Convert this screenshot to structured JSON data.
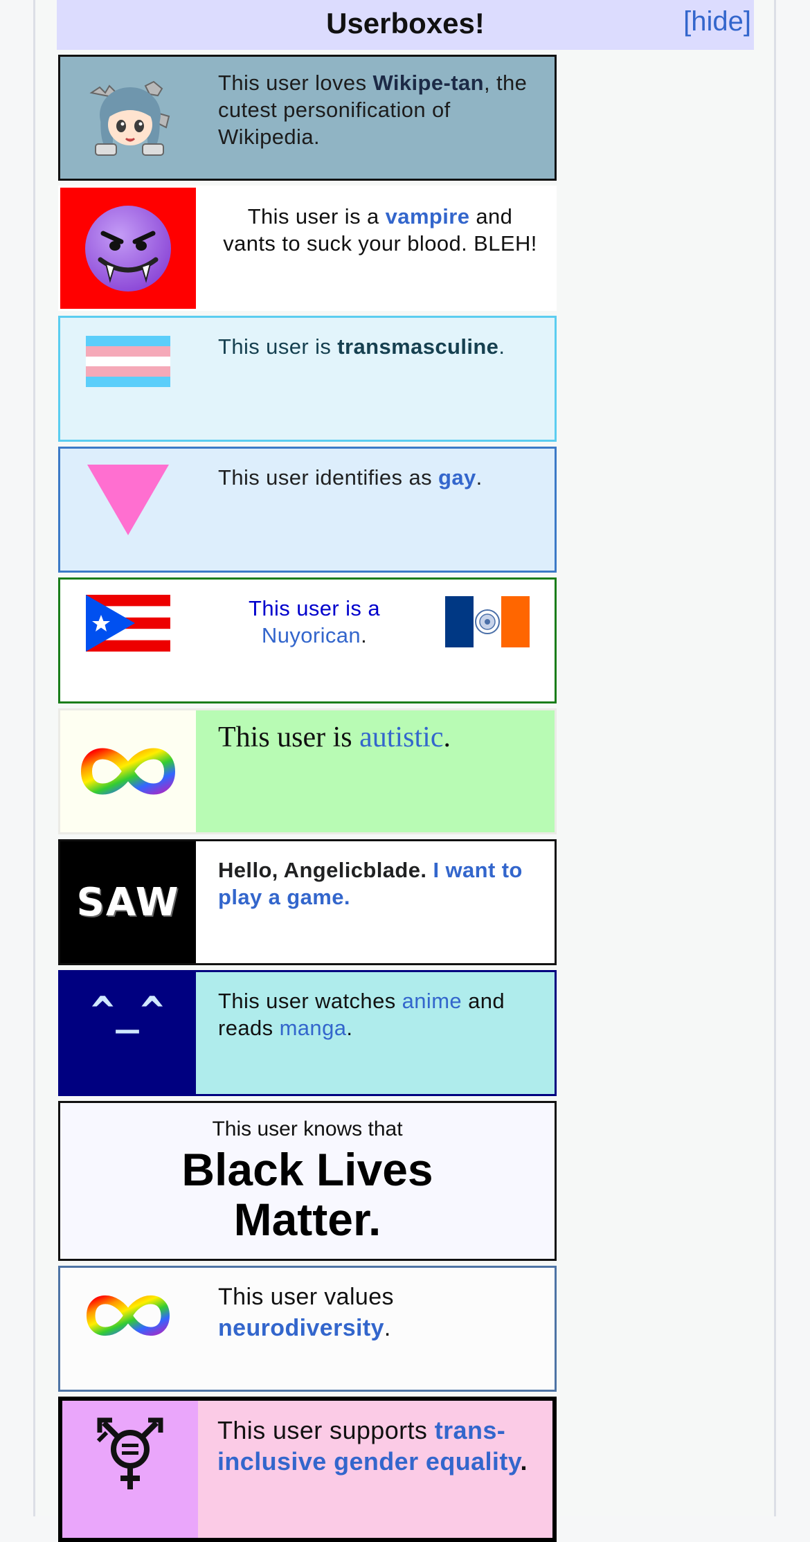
{
  "header": {
    "title": "Userboxes!",
    "hide_label": "[hide]"
  },
  "userboxes": {
    "wikipetan": {
      "pre": "This user loves ",
      "link": "Wikipe-tan",
      "post": ", the cutest personification of Wikipedia.",
      "icon": "wikipe-tan-mascot-icon"
    },
    "vampire": {
      "pre": "This user is a ",
      "link": "vampire",
      "post": " and vants to suck your blood. BLEH!",
      "icon": "purple-devil-face-icon"
    },
    "transmasc": {
      "pre": "This user is ",
      "link": "transmasculine",
      "post": ".",
      "icon": "transgender-flag-icon"
    },
    "gay": {
      "pre": "This user identifies as ",
      "link": "gay",
      "post": ".",
      "icon": "pink-triangle-icon"
    },
    "nuyorican": {
      "pre": "This user is a ",
      "link": "Nuyorican",
      "post": ".",
      "icon_left": "puerto-rico-flag-icon",
      "icon_right": "new-york-city-flag-icon"
    },
    "autistic": {
      "pre": "This user is ",
      "link": "autistic",
      "post": ".",
      "icon": "rainbow-infinity-icon"
    },
    "saw": {
      "pre": "Hello, Angelicblade. ",
      "link": "I want to play a game.",
      "icon_text": "SAW"
    },
    "anime": {
      "pre": "This user watches ",
      "link1": "anime",
      "mid": " and reads ",
      "link2": "manga",
      "post": ".",
      "icon_text": "^_^"
    },
    "blm": {
      "small": "This user knows that",
      "big": "Black Lives Matter."
    },
    "neuro": {
      "pre": "This user values ",
      "link": "neurodiversity",
      "post": ".",
      "icon": "rainbow-infinity-icon"
    },
    "transinc": {
      "pre": "This user supports ",
      "link": "trans-inclusive gender equality",
      "post": ".",
      "icon": "transgender-equality-symbol-icon"
    }
  },
  "colors": {
    "header_bg": "#dcdcfe",
    "link": "#3366cc",
    "wikipetan_bg": "#90b4c4",
    "vampire_icon_bg": "#ff0000",
    "transmasc_bg": "#e2f4fb",
    "gay_bg": "#ddeefc",
    "autistic_bg": "#b8fbb4",
    "anime_bg": "#afecec",
    "anime_icon_bg": "#000080",
    "transinc_icon_bg": "#eaa6fb",
    "transinc_bg": "#fbcbe6"
  }
}
